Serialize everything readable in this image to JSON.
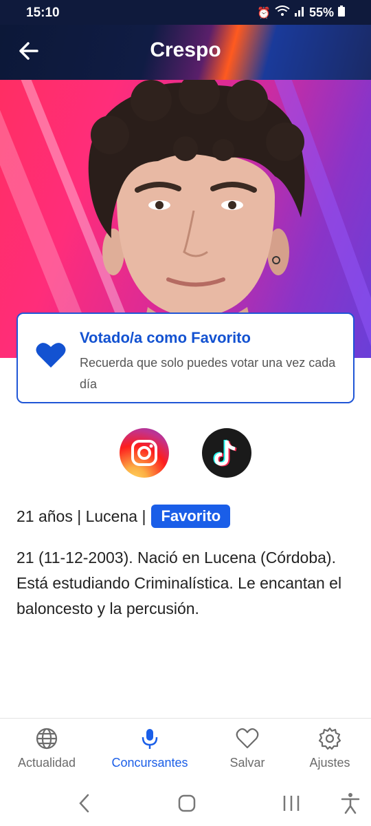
{
  "status_bar": {
    "time": "15:10",
    "battery": "55%"
  },
  "header": {
    "title": "Crespo"
  },
  "vote_card": {
    "title": "Votado/a como Favorito",
    "subtitle": "Recuerda que solo puedes votar una vez cada día"
  },
  "profile": {
    "meta": "21 años | Lucena |",
    "badge": "Favorito",
    "bio": "21 (11-12-2003). Nació en Lucena (Córdoba). Está estudiando Criminalística. Le encantan el baloncesto y la percusión."
  },
  "social": [
    {
      "icon": "instagram-icon"
    },
    {
      "icon": "tiktok-icon"
    }
  ],
  "bottom_nav": [
    {
      "label": "Actualidad",
      "icon": "globe-icon"
    },
    {
      "label": "Concursantes",
      "icon": "microphone-icon",
      "active": true
    },
    {
      "label": "Salvar",
      "icon": "heart-outline-icon"
    },
    {
      "label": "Ajustes",
      "icon": "gear-icon"
    }
  ],
  "colors": {
    "accent": "#1a5ee8",
    "header": "#0f1a3c",
    "card_border": "#1f55d6"
  }
}
